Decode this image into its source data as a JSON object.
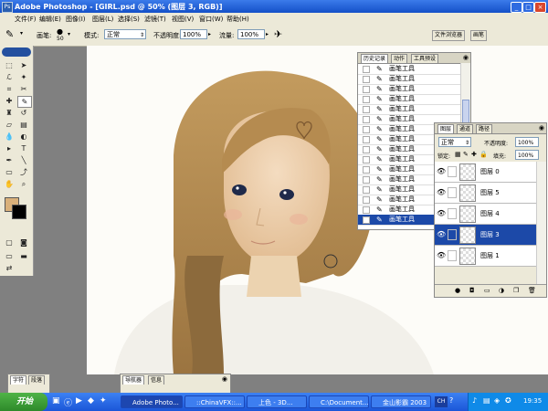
{
  "window": {
    "title": "Adobe Photoshop - [GIRL.psd @ 50% (图层 3, RGB)]"
  },
  "menu": [
    "文件(F)",
    "编辑(E)",
    "图像(I)",
    "图层(L)",
    "选择(S)",
    "滤镜(T)",
    "视图(V)",
    "窗口(W)",
    "帮助(H)"
  ],
  "options": {
    "brush_label": "画笔:",
    "brush_size": "50",
    "mode_label": "模式:",
    "mode_value": "正常",
    "opacity_label": "不透明度:",
    "opacity_value": "100%",
    "flow_label": "流量:",
    "flow_value": "100%"
  },
  "dock_tabs": [
    "文件浏览器",
    "画笔"
  ],
  "history": {
    "tabs": [
      "历史记录",
      "动作",
      "工具预设"
    ],
    "items": [
      "画笔工具",
      "画笔工具",
      "画笔工具",
      "画笔工具",
      "画笔工具",
      "画笔工具",
      "画笔工具",
      "画笔工具",
      "画笔工具",
      "画笔工具",
      "画笔工具",
      "画笔工具",
      "画笔工具",
      "画笔工具",
      "画笔工具",
      "画笔工具"
    ]
  },
  "layers": {
    "tabs": [
      "图层",
      "通道",
      "路径"
    ],
    "blend_mode": "正常",
    "opacity_label": "不透明度:",
    "opacity_value": "100%",
    "lock_label": "锁定:",
    "fill_label": "填充:",
    "fill_value": "100%",
    "items": [
      "图层 0",
      "图层 5",
      "图层 4",
      "图层 3",
      "图层 1"
    ]
  },
  "bottom_panels": [
    {
      "tabs": [
        "字符",
        "段落"
      ]
    },
    {
      "tabs": [
        "导航器",
        "信息"
      ]
    }
  ],
  "taskbar": {
    "start": "开始",
    "buttons": [
      "Adobe Photo...",
      "::ChinaVFX::...",
      "上色 - 3D...",
      "C:\\Document...",
      "金山影霸 2003"
    ],
    "tray_lang": "CH",
    "clock": "19:35"
  },
  "colors": {
    "foreground": "#d9b07a",
    "background": "#000000",
    "selection": "#1c49a8",
    "title_bar": "#1450c8"
  }
}
